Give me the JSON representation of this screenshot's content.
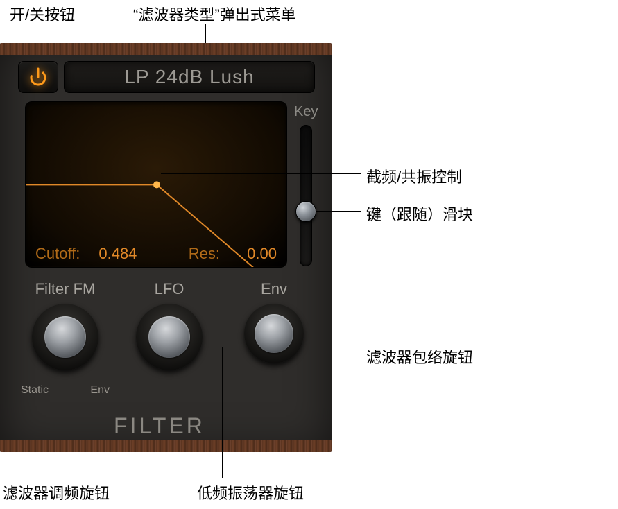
{
  "callouts": {
    "top_power": "开/关按钮",
    "top_filter_type": "“滤波器类型”弹出式菜单",
    "right_cutoff": "截频/共振控制",
    "right_key": "键（跟随）滑块",
    "right_env": "滤波器包络旋钮",
    "bottom_fm": "滤波器调频旋钮",
    "bottom_lfo": "低频振荡器旋钮"
  },
  "panel": {
    "filter_type": "LP 24dB Lush",
    "key_label": "Key",
    "section_title": "FILTER",
    "screen": {
      "cutoff_label": "Cutoff:",
      "cutoff_value": "0.484",
      "res_label": "Res:",
      "res_value": "0.00"
    },
    "knobs": {
      "fm": {
        "label": "Filter FM",
        "tick_left": "Static",
        "tick_right": "Env"
      },
      "lfo": {
        "label": "LFO"
      },
      "env": {
        "label": "Env"
      }
    }
  }
}
